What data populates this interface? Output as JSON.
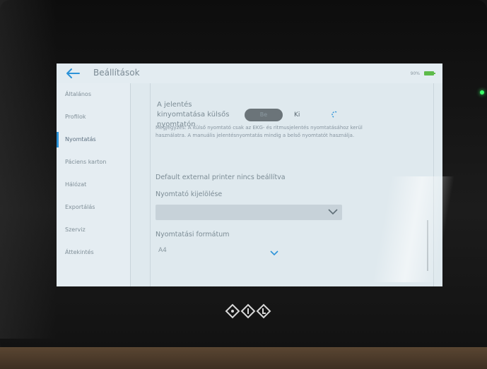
{
  "header": {
    "back_icon": "arrow-left-icon",
    "title": "Beállítások",
    "battery_text": "90%",
    "battery_color": "#5dbb4a"
  },
  "sidebar": {
    "items": [
      {
        "label": "Általános"
      },
      {
        "label": "Profilok"
      },
      {
        "label": "Nyomtatás",
        "active": true
      },
      {
        "label": "Páciens karton"
      },
      {
        "label": "Hálózat"
      },
      {
        "label": "Exportálás"
      },
      {
        "label": "Szerviz"
      },
      {
        "label": "Áttekintés"
      }
    ],
    "accent": "#2d93d8"
  },
  "main": {
    "print_label": "A jelentés kinyomtatása külsős nyomtatón",
    "toggle_on": "Be",
    "toggle_off": "Ki",
    "note": "Megjegyzés: A külső nyomtató csak az EKG- és ritmusjelentés nyomtatásához kerül használatra. A manuális jelentésnyomtatás mindig a belső nyomtatót használja.",
    "default_printer_label": "Default external printer",
    "default_printer_value": "nincs beállítva",
    "printer_select_label": "Nyomtató kijelölése",
    "printer_select_value": "",
    "format_label": "Nyomtatási formátum",
    "format_value": "A4"
  },
  "device": {
    "logo": "BTL",
    "status_led_color": "#3cff6a"
  }
}
